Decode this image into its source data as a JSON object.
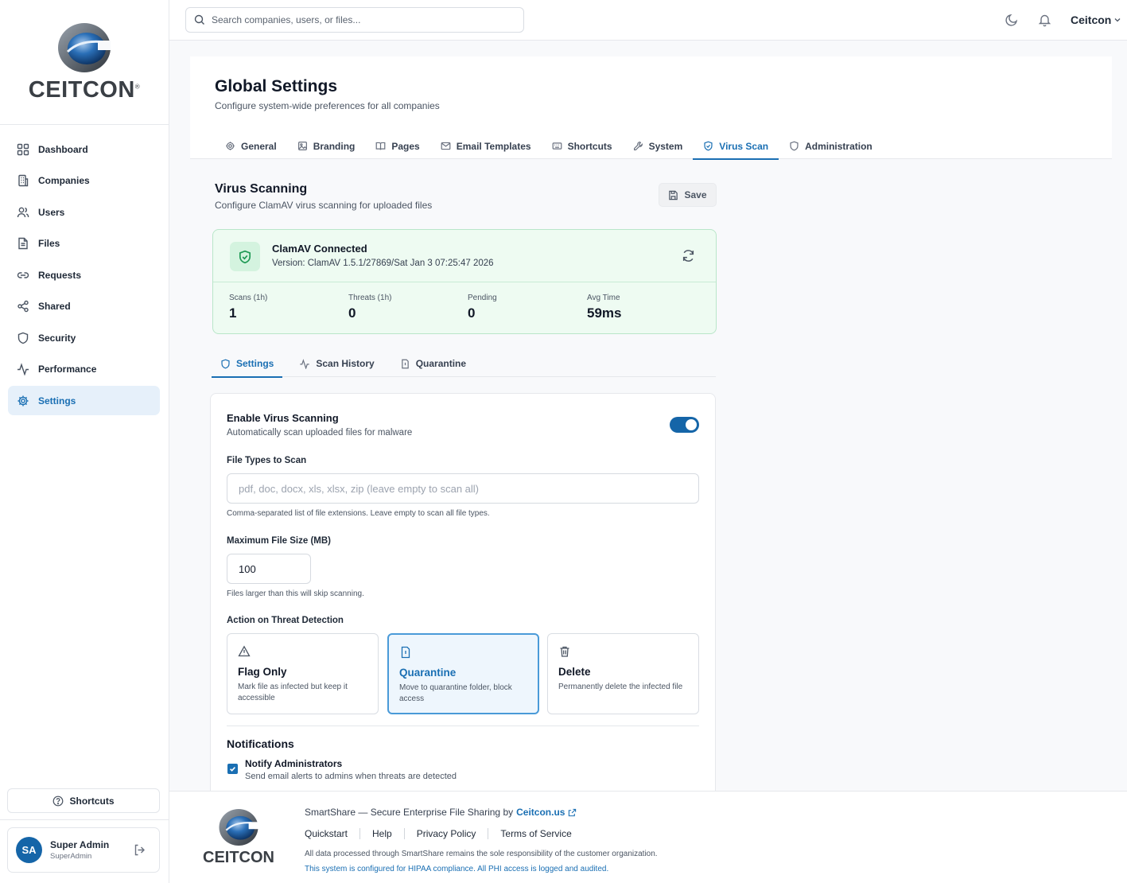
{
  "brand": {
    "name": "CEITCON",
    "mark": "®"
  },
  "search": {
    "placeholder": "Search companies, users, or files..."
  },
  "topbar": {
    "company": "Ceitcon"
  },
  "sidebar": {
    "items": [
      {
        "label": "Dashboard",
        "icon": "grid-icon"
      },
      {
        "label": "Companies",
        "icon": "building-icon"
      },
      {
        "label": "Users",
        "icon": "users-icon"
      },
      {
        "label": "Files",
        "icon": "file-icon"
      },
      {
        "label": "Requests",
        "icon": "link-icon"
      },
      {
        "label": "Shared",
        "icon": "share-icon"
      },
      {
        "label": "Security",
        "icon": "shield-icon"
      },
      {
        "label": "Performance",
        "icon": "activity-icon"
      },
      {
        "label": "Settings",
        "icon": "gear-icon",
        "active": true
      }
    ],
    "shortcuts_label": "Shortcuts",
    "user": {
      "initials": "SA",
      "name": "Super Admin",
      "role": "SuperAdmin"
    }
  },
  "page": {
    "title": "Global Settings",
    "subtitle": "Configure system-wide preferences for all companies",
    "tabs": [
      {
        "label": "General",
        "icon": "gear-icon"
      },
      {
        "label": "Branding",
        "icon": "image-icon"
      },
      {
        "label": "Pages",
        "icon": "book-icon"
      },
      {
        "label": "Email Templates",
        "icon": "mail-icon"
      },
      {
        "label": "Shortcuts",
        "icon": "keyboard-icon"
      },
      {
        "label": "System",
        "icon": "wrench-icon"
      },
      {
        "label": "Virus Scan",
        "icon": "shield-check-icon",
        "active": true
      },
      {
        "label": "Administration",
        "icon": "shield-icon"
      }
    ]
  },
  "virus": {
    "title": "Virus Scanning",
    "subtitle": "Configure ClamAV virus scanning for uploaded files",
    "save_label": "Save",
    "status": {
      "title": "ClamAV Connected",
      "version": "Version: ClamAV 1.5.1/27869/Sat Jan 3 07:25:47 2026",
      "color": "#1f9a55"
    },
    "stats": [
      {
        "label": "Scans (1h)",
        "value": "1"
      },
      {
        "label": "Threats (1h)",
        "value": "0"
      },
      {
        "label": "Pending",
        "value": "0"
      },
      {
        "label": "Avg Time",
        "value": "59ms"
      }
    ],
    "subtabs": [
      {
        "label": "Settings",
        "icon": "shield-icon",
        "active": true
      },
      {
        "label": "Scan History",
        "icon": "activity-icon"
      },
      {
        "label": "Quarantine",
        "icon": "quarantine-icon"
      }
    ],
    "enable": {
      "title": "Enable Virus Scanning",
      "desc": "Automatically scan uploaded files for malware",
      "enabled": true
    },
    "file_types": {
      "label": "File Types to Scan",
      "value": "",
      "placeholder": "pdf, doc, docx, xls, xlsx, zip (leave empty to scan all)",
      "help": "Comma-separated list of file extensions. Leave empty to scan all file types."
    },
    "max_size": {
      "label": "Maximum File Size (MB)",
      "value": "100",
      "help": "Files larger than this will skip scanning."
    },
    "action": {
      "label": "Action on Threat Detection",
      "options": [
        {
          "title": "Flag Only",
          "desc": "Mark file as infected but keep it accessible",
          "icon": "warning-icon"
        },
        {
          "title": "Quarantine",
          "desc": "Move to quarantine folder, block access",
          "icon": "quarantine-icon",
          "selected": true
        },
        {
          "title": "Delete",
          "desc": "Permanently delete the infected file",
          "icon": "trash-icon"
        }
      ]
    },
    "notifications": {
      "title": "Notifications",
      "option": "Notify Administrators",
      "desc": "Send email alerts to admins when threats are detected",
      "checked": true
    }
  },
  "footer": {
    "tagline": "SmartShare — Secure Enterprise File Sharing by",
    "brand_link": "Ceitcon.us",
    "links": [
      "Quickstart",
      "Help",
      "Privacy Policy",
      "Terms of Service"
    ],
    "note1": "All data processed through SmartShare remains the sole responsibility of the customer organization.",
    "note2": "This system is configured for HIPAA compliance. All PHI access is logged and audited."
  },
  "colors": {
    "accent": "#1a6fb3",
    "success": "#1f9a55",
    "avatar": "#1565a8"
  }
}
